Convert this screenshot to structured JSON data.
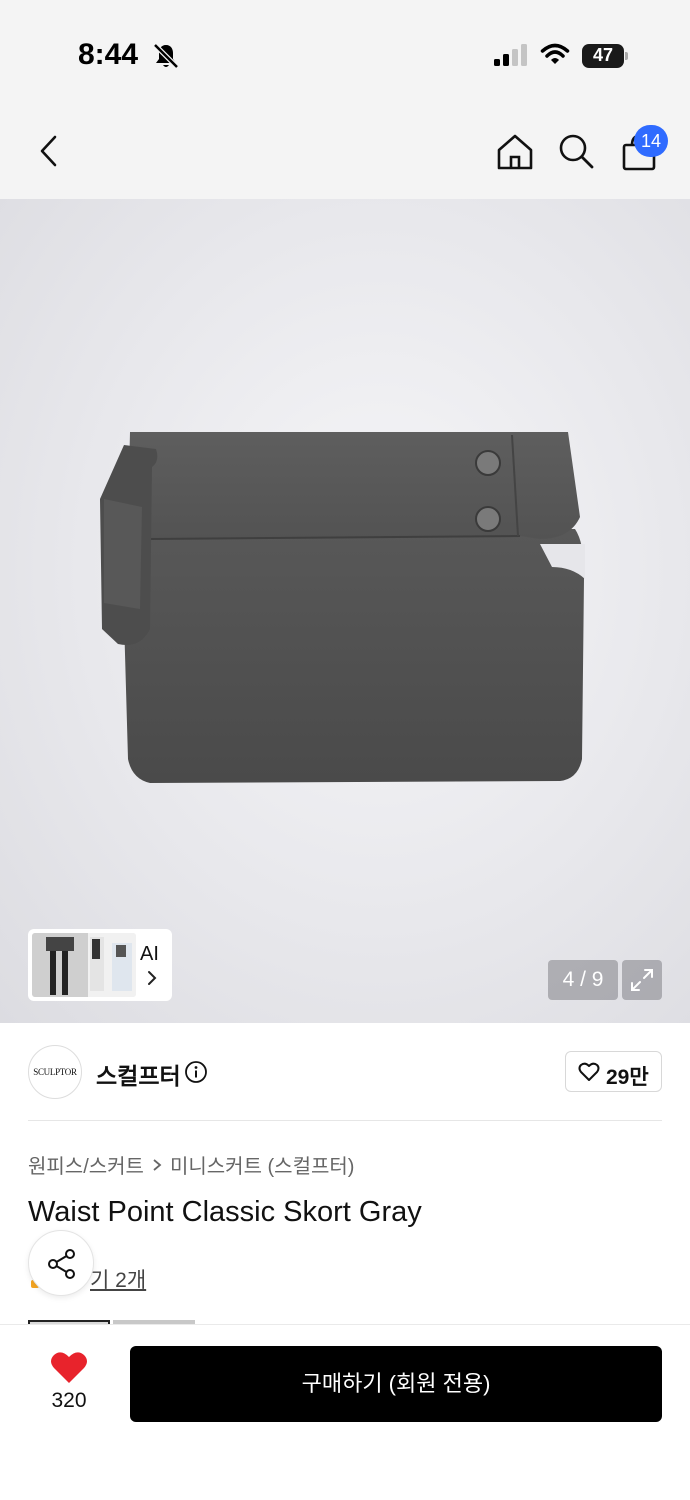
{
  "status_bar": {
    "time": "8:44",
    "battery": "47",
    "icons": [
      "bell-slash-icon",
      "signal-icon",
      "wifi-icon",
      "battery-icon"
    ]
  },
  "nav": {
    "icons": [
      "back-icon",
      "home-icon",
      "search-icon",
      "shopping-bag-icon"
    ],
    "cart_count": "14"
  },
  "gallery": {
    "ai_label": "AI",
    "counter": "4 / 9",
    "expand_icon": "expand-icon"
  },
  "brand": {
    "logo_text": "SCULPTOR",
    "name": "스컬프터",
    "likes": "29만"
  },
  "product": {
    "breadcrumb": [
      "원피스/스커트",
      "미니스커트 (스컬프터)"
    ],
    "title": "Waist Point Classic Skort Gray",
    "reviews": "기 2개"
  },
  "bottom_bar": {
    "wish_count": "320",
    "buy_label": "구매하기 (회원 전용)",
    "heart_color": "#e8232c"
  }
}
